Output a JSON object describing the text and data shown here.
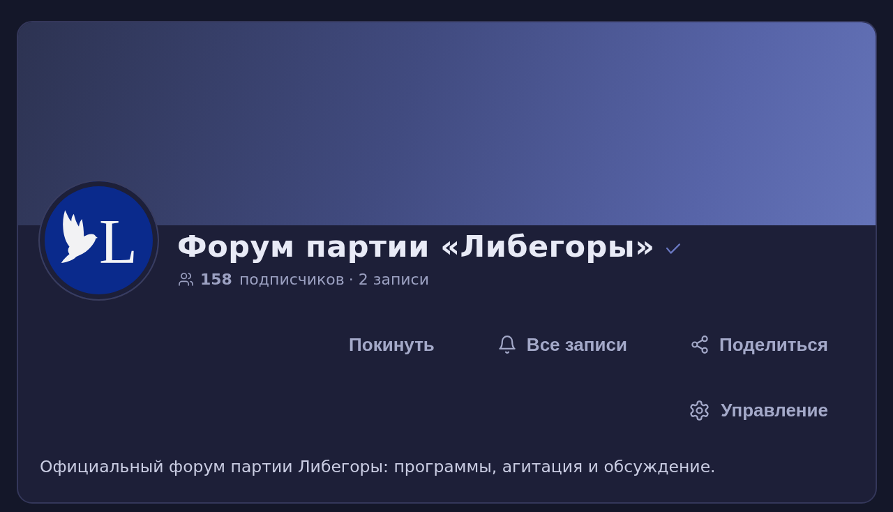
{
  "channel": {
    "avatar": {
      "letter": "L"
    },
    "title": "Форум партии «Либегоры»",
    "verified": true,
    "stats": {
      "subscribers_count": "158",
      "subscribers_label": "подписчиков",
      "posts": "· 2 записи"
    },
    "actions": [
      {
        "kind": "plain",
        "label": "Покинуть"
      },
      {
        "kind": "bell",
        "label": "Все записи"
      },
      {
        "kind": "share",
        "label": "Поделиться"
      },
      {
        "kind": "gear",
        "label": "Управление"
      }
    ],
    "description": "Официальный форум партии Либегоры: программы, агитация и обсуждение."
  }
}
